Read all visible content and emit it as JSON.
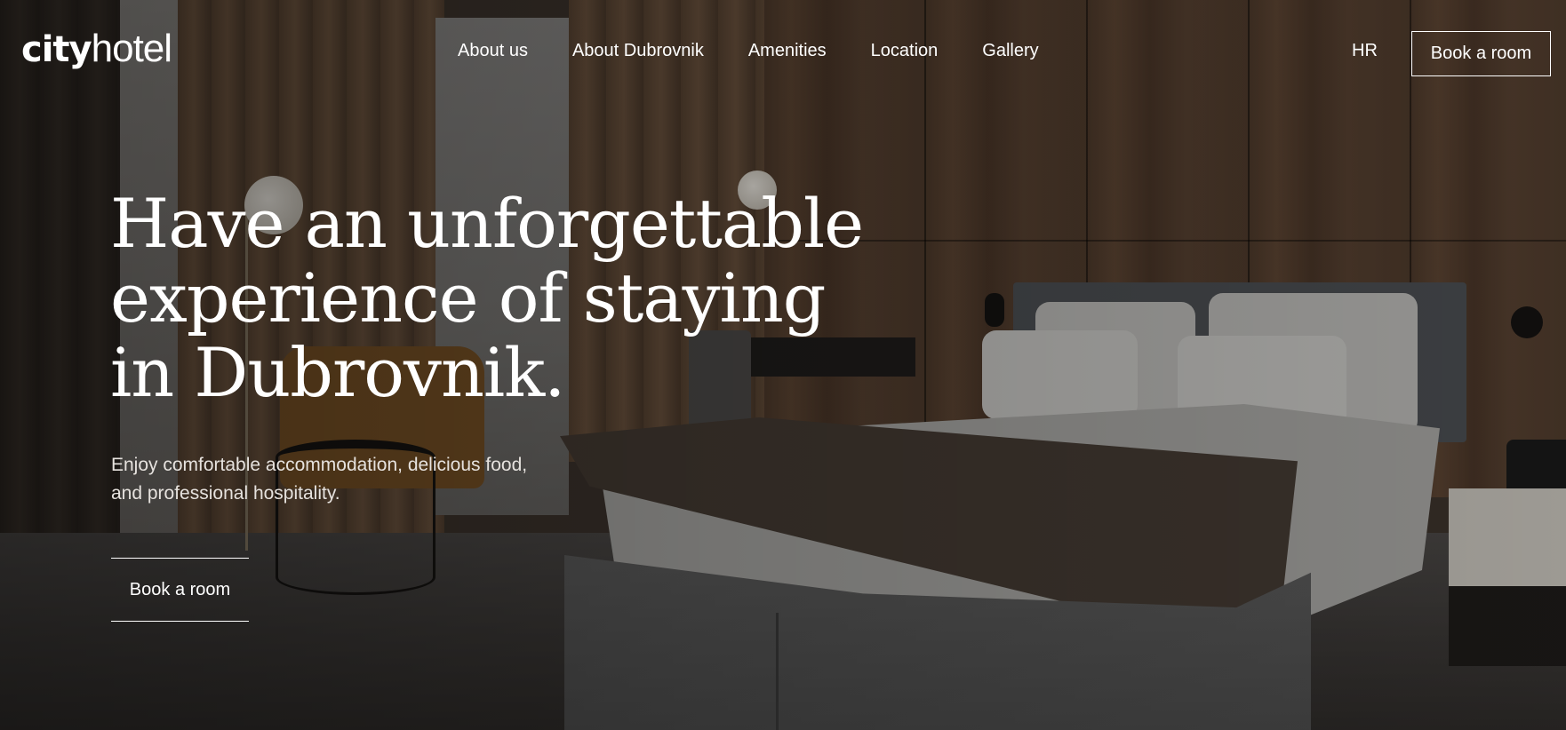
{
  "header": {
    "logo": {
      "bold_part": "city",
      "light_part": "hotel"
    },
    "nav": [
      {
        "label": "About us"
      },
      {
        "label": "About Dubrovnik"
      },
      {
        "label": "Amenities"
      },
      {
        "label": "Location"
      },
      {
        "label": "Gallery"
      }
    ],
    "language_link": "HR",
    "book_button": "Book a room"
  },
  "hero": {
    "title_lines": [
      "Have an unforgettable",
      "experience of staying",
      "in Dubrovnik."
    ],
    "subtitle_lines": [
      "Enjoy comfortable accommodation, delicious food,",
      "and professional hospitality."
    ],
    "cta_button": "Book a room",
    "background_image": "hotel-room-photo"
  },
  "colors": {
    "text": "#ffffff",
    "subtitle_text": "#e6e2de",
    "overlay": "#000000"
  }
}
